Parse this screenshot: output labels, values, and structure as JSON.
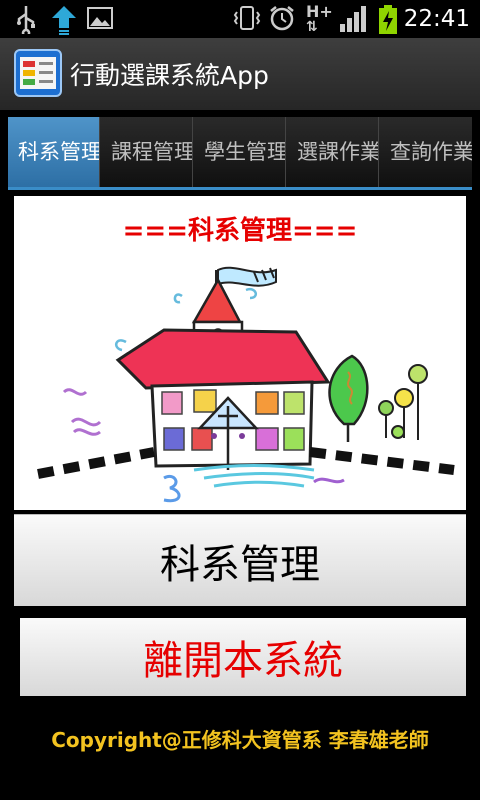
{
  "status_bar": {
    "time": "22:41",
    "icons": [
      "usb-icon",
      "upload-icon",
      "image-icon",
      "vibrate-icon",
      "alarm-icon",
      "hplus-data-icon",
      "signal-icon",
      "battery-charging-icon"
    ],
    "network_label": "H+"
  },
  "app": {
    "title": "行動選課系統App"
  },
  "tabs": [
    {
      "label": "科系管理",
      "active": true
    },
    {
      "label": "課程管理",
      "active": false
    },
    {
      "label": "學生管理",
      "active": false
    },
    {
      "label": "選課作業",
      "active": false
    },
    {
      "label": "查詢作業",
      "active": false
    }
  ],
  "panel": {
    "title": "===科系管理==="
  },
  "buttons": {
    "main_label": "科系管理",
    "exit_label": "離開本系統"
  },
  "footer": {
    "copyright": "Copyright@正修科大資管系  李春雄老師"
  },
  "colors": {
    "accent": "#3a8dc8",
    "title_red": "#e60000",
    "footer_yellow": "#f3c320"
  }
}
